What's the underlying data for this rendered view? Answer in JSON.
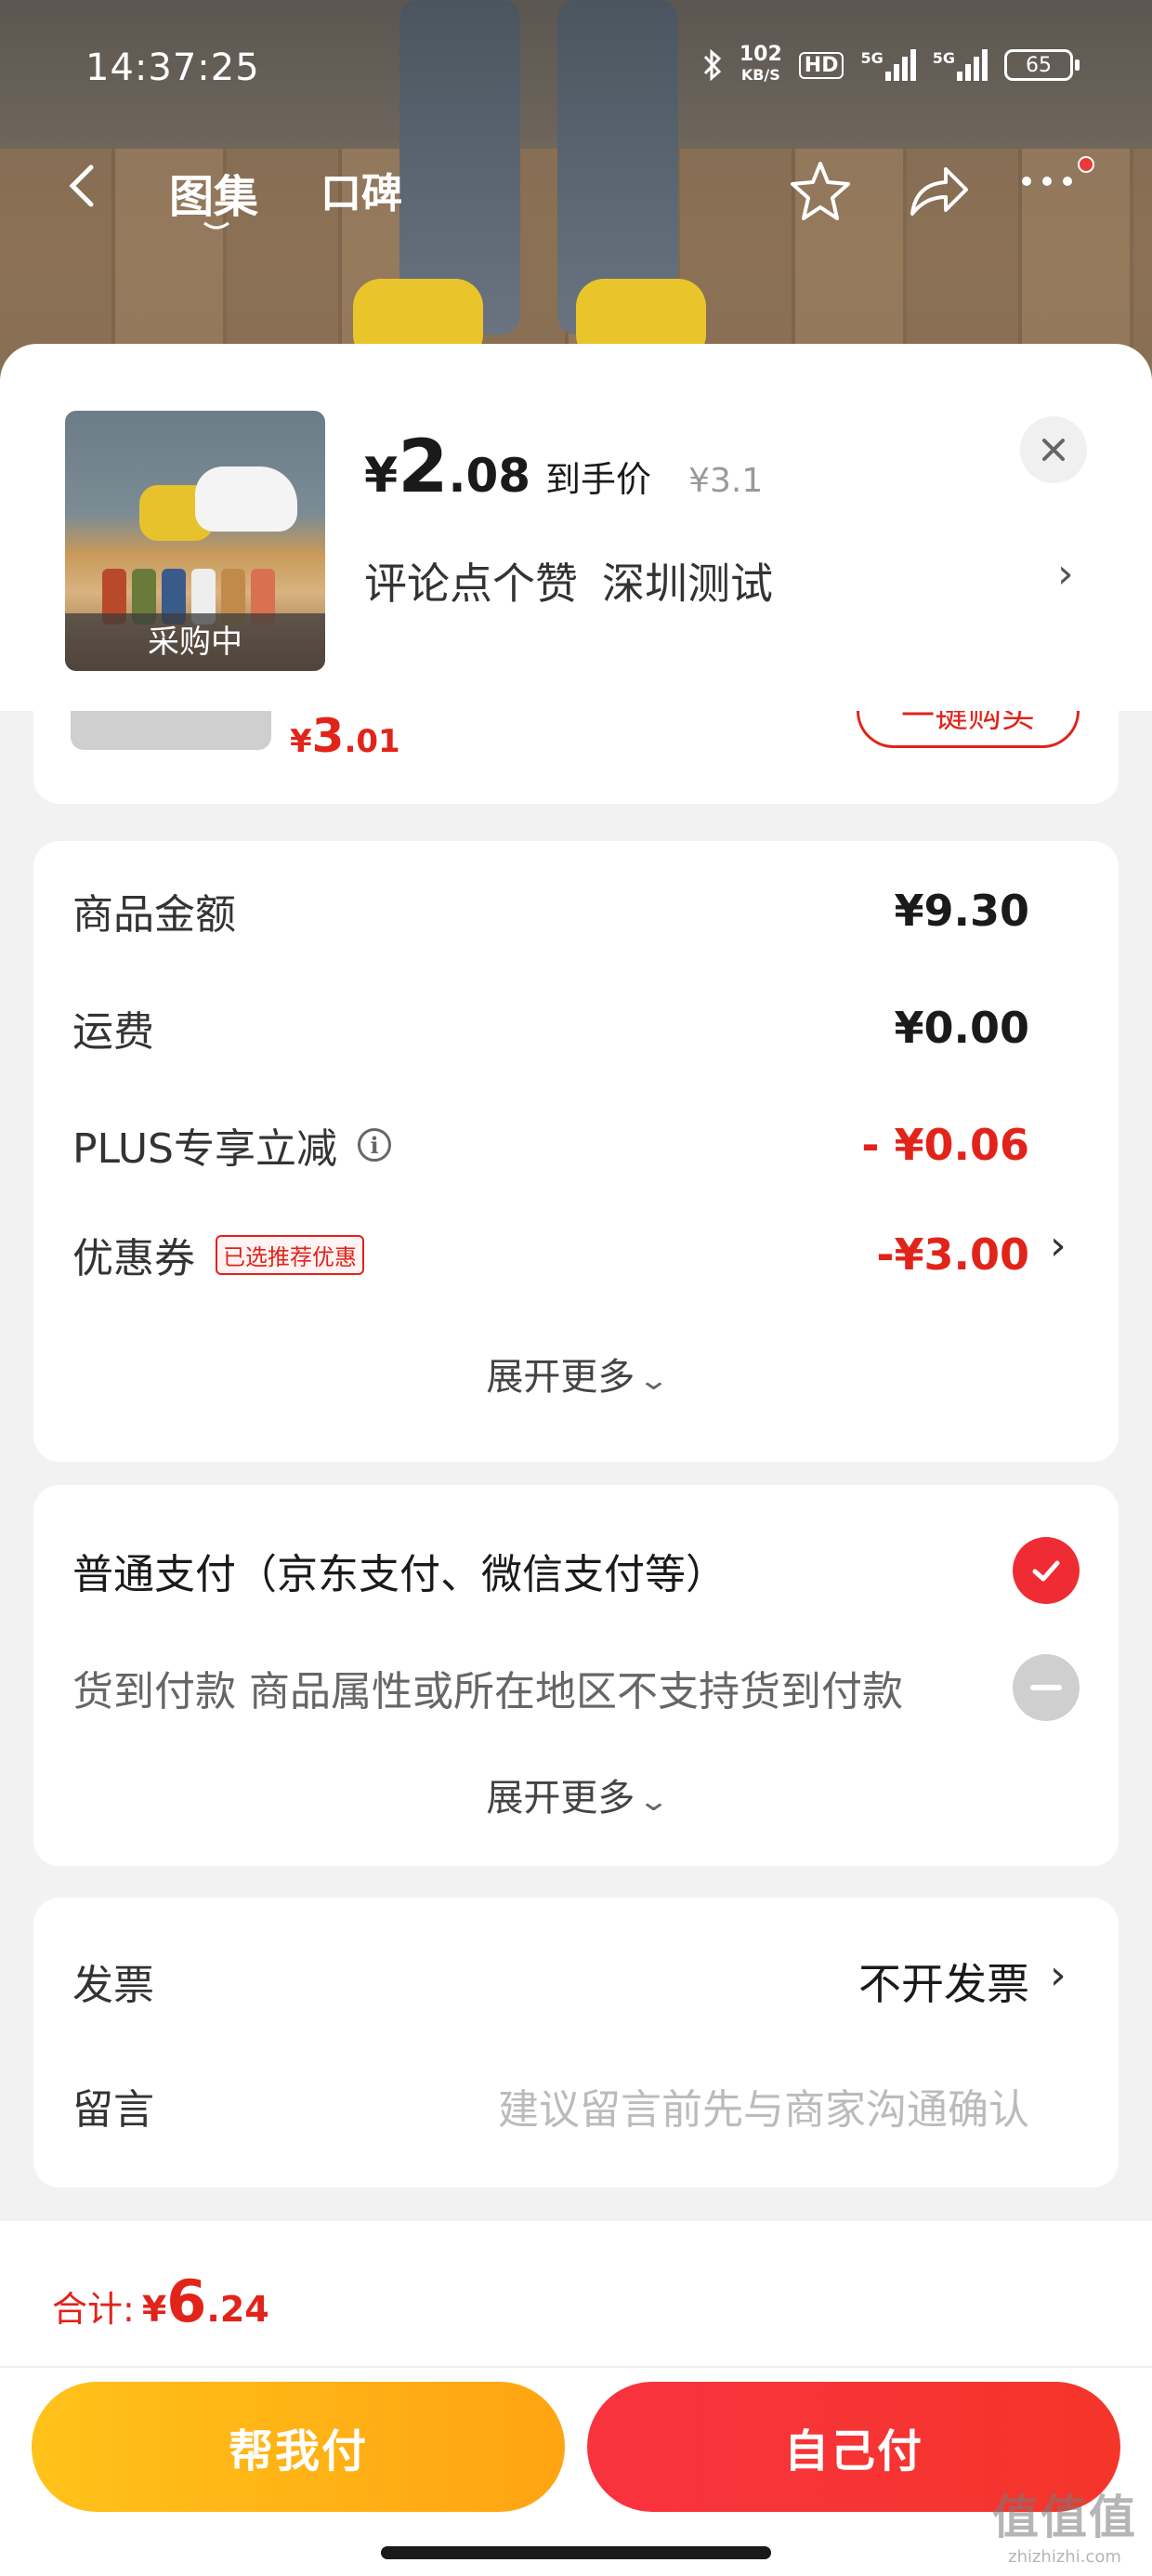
{
  "status_bar": {
    "time": "14:37:25",
    "net_speed": "102",
    "net_unit": "KB/S",
    "hd": "HD",
    "sig1": "5G",
    "sig2": "5G",
    "battery": "65"
  },
  "nav": {
    "tabs": [
      "图集",
      "口碑"
    ]
  },
  "product": {
    "badge": "采购中",
    "price_symbol": "¥",
    "price_int": "2",
    "price_dec": ".08",
    "price_label": "到手价",
    "original_price": "¥3.1",
    "spec": "评论点个赞",
    "location": "深圳测试",
    "peek_price_symbol": "¥",
    "peek_price_int": "3",
    "peek_price_dec": ".01",
    "peek_button": "一键购买"
  },
  "summary": {
    "rows": [
      {
        "label": "商品金额",
        "value": "¥9.30"
      },
      {
        "label": "运费",
        "value": "¥0.00"
      },
      {
        "label": "PLUS专享立减",
        "value": "- ¥0.06"
      },
      {
        "label": "优惠券",
        "tag": "已选推荐优惠",
        "value": "-¥3.00"
      }
    ],
    "expand": "展开更多"
  },
  "payment": {
    "options": [
      {
        "label": "普通支付（京东支付、微信支付等）",
        "state": "selected"
      },
      {
        "label": "货到付款 商品属性或所在地区不支持货到付款",
        "state": "disabled"
      }
    ],
    "expand": "展开更多"
  },
  "extra": {
    "invoice_label": "发票",
    "invoice_value": "不开发票",
    "message_label": "留言",
    "message_placeholder": "建议留言前先与商家沟通确认"
  },
  "footer": {
    "total_label": "合计:",
    "total_symbol": "¥",
    "total_int": "6",
    "total_dec": ".24",
    "help_pay": "帮我付",
    "self_pay": "自己付"
  },
  "watermark": {
    "big": "值值值",
    "small": "zhizhizhi.com"
  },
  "colors": {
    "accent_red": "#e2231a",
    "help_yellow": "#ffb515",
    "self_red": "#f5333a"
  }
}
